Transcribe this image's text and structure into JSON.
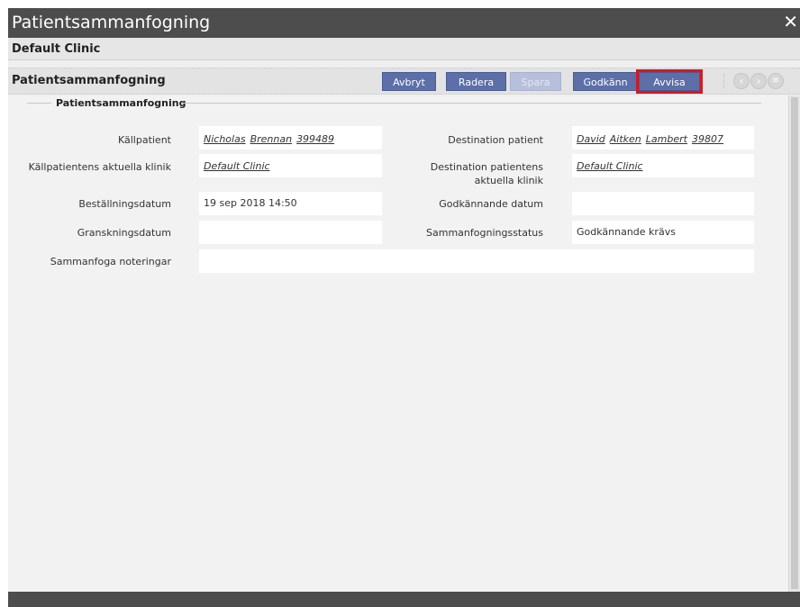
{
  "window": {
    "title": "Patientsammanfogning",
    "close_icon": "close-icon"
  },
  "clinic": "Default Clinic",
  "toolbar": {
    "title": "Patientsammanfogning",
    "buttons": {
      "cancel": "Avbryt",
      "delete": "Radera",
      "save": "Spara",
      "approve": "Godkänn",
      "reject": "Avvisa"
    },
    "nav_icons": [
      "chevron-left-icon",
      "chevron-right-icon",
      "menu-icon"
    ],
    "button_color": "#5c6fa8",
    "highlight_color": "#d11a24"
  },
  "section": {
    "title": "Patientsammanfogning"
  },
  "form": {
    "source_patient_label": "Källpatient",
    "source_patient_parts": [
      "Nicholas",
      "Brennan",
      "399489"
    ],
    "destination_patient_label": "Destination patient",
    "destination_patient_parts": [
      "David",
      "Aitken",
      "Lambert",
      "39807"
    ],
    "source_clinic_label": "Källpatientens aktuella klinik",
    "source_clinic_value": "Default Clinic",
    "destination_clinic_label_line1": "Destination patientens",
    "destination_clinic_label_line2": "aktuella klinik",
    "destination_clinic_value": "Default Clinic",
    "order_date_label": "Beställningsdatum",
    "order_date_value": "19 sep 2018 14:50",
    "approval_date_label": "Godkännande datum",
    "approval_date_value": "",
    "review_date_label": "Granskningsdatum",
    "review_date_value": "",
    "merge_status_label": "Sammanfogningsstatus",
    "merge_status_value": "Godkännande krävs",
    "merge_notes_label": "Sammanfoga noteringar",
    "merge_notes_value": ""
  }
}
